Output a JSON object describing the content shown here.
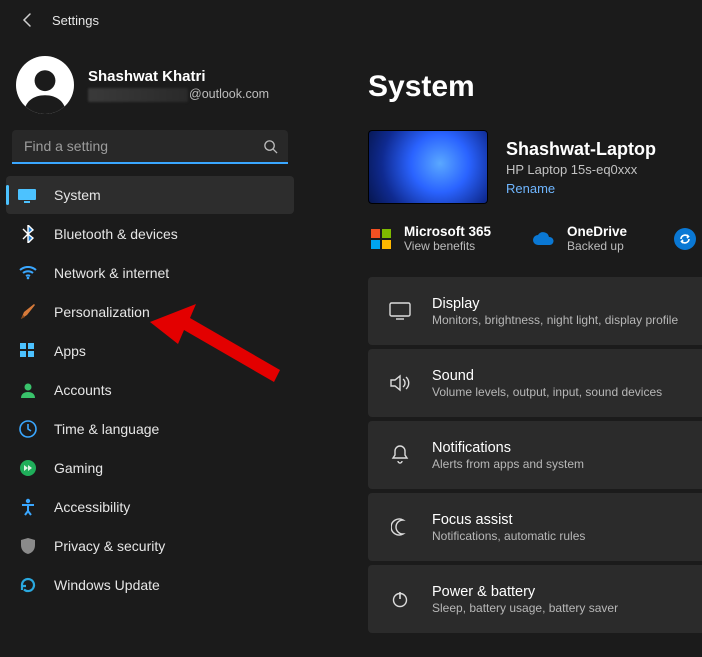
{
  "window": {
    "title": "Settings"
  },
  "account": {
    "name": "Shashwat Khatri",
    "email_domain": "@outlook.com"
  },
  "search": {
    "placeholder": "Find a setting"
  },
  "nav": {
    "items": [
      {
        "label": "System"
      },
      {
        "label": "Bluetooth & devices"
      },
      {
        "label": "Network & internet"
      },
      {
        "label": "Personalization"
      },
      {
        "label": "Apps"
      },
      {
        "label": "Accounts"
      },
      {
        "label": "Time & language"
      },
      {
        "label": "Gaming"
      },
      {
        "label": "Accessibility"
      },
      {
        "label": "Privacy & security"
      },
      {
        "label": "Windows Update"
      }
    ]
  },
  "page": {
    "title": "System"
  },
  "device": {
    "name": "Shashwat-Laptop",
    "model": "HP Laptop 15s-eq0xxx",
    "rename_label": "Rename"
  },
  "services": {
    "ms365": {
      "title": "Microsoft 365",
      "sub": "View benefits"
    },
    "onedrive": {
      "title": "OneDrive",
      "sub": "Backed up"
    }
  },
  "cards": [
    {
      "title": "Display",
      "sub": "Monitors, brightness, night light, display profile"
    },
    {
      "title": "Sound",
      "sub": "Volume levels, output, input, sound devices"
    },
    {
      "title": "Notifications",
      "sub": "Alerts from apps and system"
    },
    {
      "title": "Focus assist",
      "sub": "Notifications, automatic rules"
    },
    {
      "title": "Power & battery",
      "sub": "Sleep, battery usage, battery saver"
    }
  ]
}
